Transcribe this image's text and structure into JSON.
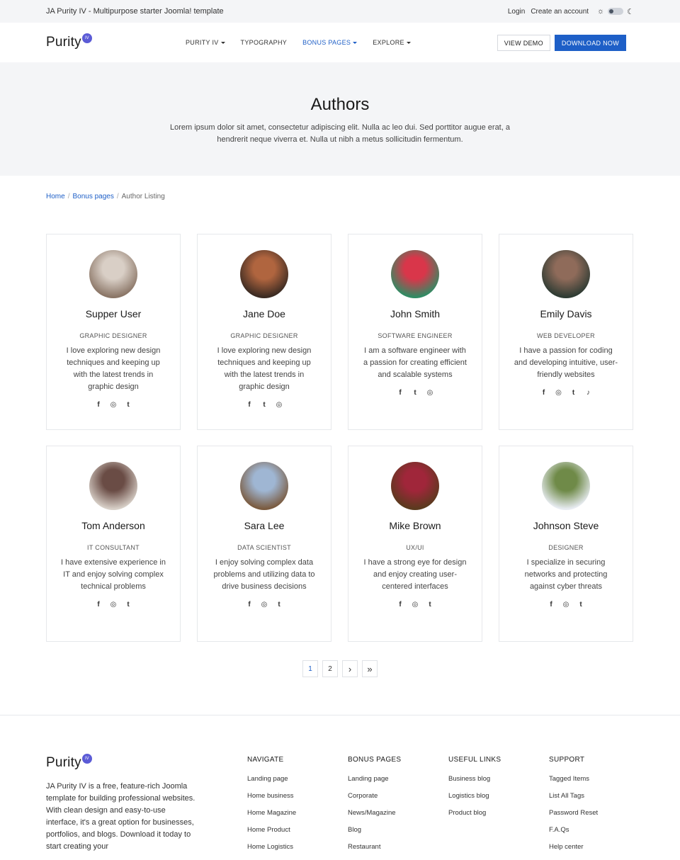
{
  "topbar": {
    "tagline": "JA Purity IV - Multipurpose starter Joomla! template",
    "login": "Login",
    "create_account": "Create an account",
    "sun_icon": "☼",
    "moon_icon": "☾"
  },
  "header": {
    "logo": "Purity",
    "logo_badge": "IV",
    "nav": [
      {
        "label": "Purity IV",
        "dropdown": true
      },
      {
        "label": "Typography",
        "dropdown": false
      },
      {
        "label": "Bonus Pages",
        "dropdown": true,
        "active": true
      },
      {
        "label": "Explore",
        "dropdown": true
      }
    ],
    "view_demo": "VIEW DEMO",
    "download_now": "DOWNLOAD NOW"
  },
  "hero": {
    "title": "Authors",
    "text": "Lorem ipsum dolor sit amet, consectetur adipiscing elit. Nulla ac leo dui. Sed porttitor augue erat, a hendrerit neque viverra et. Nulla ut nibh a metus sollicitudin fermentum."
  },
  "breadcrumb": {
    "home": "Home",
    "bonus": "Bonus pages",
    "current": "Author Listing"
  },
  "authors": [
    {
      "name": "Supper User",
      "role": "GRAPHIC DESIGNER",
      "bio": "I love exploring new design techniques and keeping up with the latest trends in graphic design",
      "socials": [
        "f",
        "◎",
        "t"
      ],
      "avatar_colors": [
        "#d9cfc6",
        "#8a7566"
      ]
    },
    {
      "name": "Jane Doe",
      "role": "GRAPHIC DESIGNER",
      "bio": "I love exploring new design techniques and keeping up with the latest trends in graphic design",
      "socials": [
        "f",
        "t",
        "◎"
      ],
      "avatar_colors": [
        "#b0653f",
        "#3a2a22"
      ]
    },
    {
      "name": "John Smith",
      "role": "SOFTWARE ENGINEER",
      "bio": "I am a software engineer with a passion for creating efficient and scalable systems",
      "socials": [
        "f",
        "t",
        "◎"
      ],
      "avatar_colors": [
        "#d9364a",
        "#2f8c64"
      ]
    },
    {
      "name": "Emily Davis",
      "role": "WEB DEVELOPER",
      "bio": "I have a passion for coding and developing intuitive, user-friendly websites",
      "socials": [
        "f",
        "◎",
        "t",
        "♪"
      ],
      "avatar_colors": [
        "#8f6b5a",
        "#2e3b33"
      ]
    },
    {
      "name": "Tom Anderson",
      "role": "IT CONSULTANT",
      "bio": "I have extensive experience in IT and enjoy solving complex technical problems",
      "socials": [
        "f",
        "◎",
        "t"
      ],
      "avatar_colors": [
        "#6a4c45",
        "#d8d0c8"
      ]
    },
    {
      "name": "Sara Lee",
      "role": "DATA SCIENTIST",
      "bio": "I enjoy solving complex data problems and utilizing data to drive business decisions",
      "socials": [
        "f",
        "◎",
        "t"
      ],
      "avatar_colors": [
        "#9fb6d3",
        "#7a5a3e"
      ]
    },
    {
      "name": "Mike Brown",
      "role": "UX/UI",
      "bio": "I have a strong eye for design and enjoy creating user-centered interfaces",
      "socials": [
        "f",
        "◎",
        "t"
      ],
      "avatar_colors": [
        "#a0263a",
        "#5a3a1e"
      ]
    },
    {
      "name": "Johnson Steve",
      "role": "DESIGNER",
      "bio": "I specialize in securing networks and protecting against cyber threats",
      "socials": [
        "f",
        "◎",
        "t"
      ],
      "avatar_colors": [
        "#6f8a48",
        "#e8ecf2"
      ]
    }
  ],
  "pagination": {
    "pages": [
      "1",
      "2"
    ],
    "next": "›",
    "last": "»"
  },
  "footer": {
    "logo": "Purity",
    "logo_badge": "IV",
    "about": "JA Purity IV is a free, feature-rich Joomla template for building professional websites. With clean design and easy-to-use interface, it's a great option for businesses, portfolios, and blogs. Download it today to start creating your",
    "columns": [
      {
        "title": "Navigate",
        "links": [
          "Landing page",
          "Home business",
          "Home Magazine",
          "Home Product",
          "Home Logistics"
        ]
      },
      {
        "title": "Bonus pages",
        "links": [
          "Landing page",
          "Corporate",
          "News/Magazine",
          "Blog",
          "Restaurant"
        ]
      },
      {
        "title": "Useful links",
        "links": [
          "Business blog",
          "Logistics blog",
          "Product blog"
        ]
      },
      {
        "title": "Support",
        "links": [
          "Tagged Items",
          "List All Tags",
          "Password Reset",
          "F.A.Qs",
          "Help center"
        ]
      }
    ]
  },
  "colors": {
    "accent": "#1e5fc7",
    "badge": "#5b5bd6",
    "hero_bg": "#f4f5f7"
  }
}
